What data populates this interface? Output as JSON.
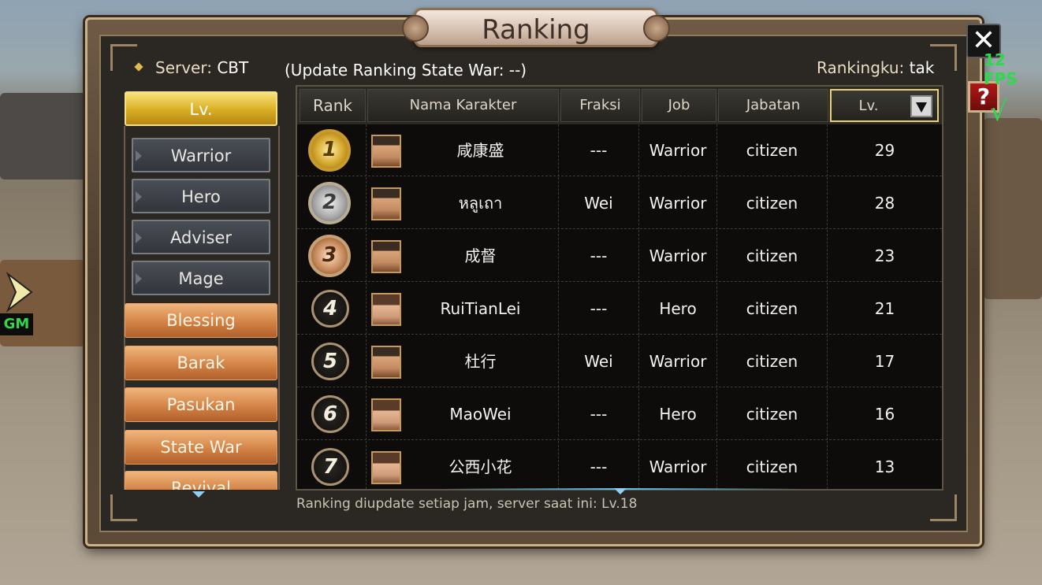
{
  "title": "Ranking",
  "server_label": "Server:",
  "server_value": "CBT",
  "update_text": "(Update Ranking State War: --)",
  "my_rank_label": "Rankingku:",
  "my_rank_value": "tak",
  "left_menu": {
    "active": "Lv.",
    "sub_items": [
      "Warrior",
      "Hero",
      "Adviser",
      "Mage"
    ],
    "items": [
      "Blessing",
      "Barak",
      "Pasukan",
      "State War",
      "Revival"
    ]
  },
  "table": {
    "headers": [
      "Rank",
      "Nama Karakter",
      "Fraksi",
      "Job",
      "Jabatan",
      "Lv."
    ],
    "rows": [
      {
        "rank": "1",
        "name": "咸康盛",
        "fraksi": "---",
        "job": "Warrior",
        "jabatan": "citizen",
        "lv": "29"
      },
      {
        "rank": "2",
        "name": "หลูเถา",
        "fraksi": "Wei",
        "job": "Warrior",
        "jabatan": "citizen",
        "lv": "28"
      },
      {
        "rank": "3",
        "name": "成督",
        "fraksi": "---",
        "job": "Warrior",
        "jabatan": "citizen",
        "lv": "23"
      },
      {
        "rank": "4",
        "name": "RuiTianLei",
        "fraksi": "---",
        "job": "Hero",
        "jabatan": "citizen",
        "lv": "21"
      },
      {
        "rank": "5",
        "name": "杜行",
        "fraksi": "Wei",
        "job": "Warrior",
        "jabatan": "citizen",
        "lv": "17"
      },
      {
        "rank": "6",
        "name": "MaoWei",
        "fraksi": "---",
        "job": "Hero",
        "jabatan": "citizen",
        "lv": "16"
      },
      {
        "rank": "7",
        "name": "公西小花",
        "fraksi": "---",
        "job": "Warrior",
        "jabatan": "citizen",
        "lv": "13"
      }
    ]
  },
  "footer_note": "Ranking diupdate setiap jam, server saat ini: Lv.18",
  "overlay": {
    "fps": "12 FPS",
    "gm": "GM",
    "close_glyph": "✕",
    "help_glyph": "?",
    "check_glyph": "√"
  },
  "icons": [
    "close-icon",
    "help-icon",
    "sort-down-icon",
    "gm-arrow-icon",
    "medal-icon",
    "avatar-icon"
  ],
  "colors": {
    "gold": "#d9ad22",
    "orange": "#d38346",
    "fps_green": "#2ed94b",
    "help_red": "#b01818"
  }
}
